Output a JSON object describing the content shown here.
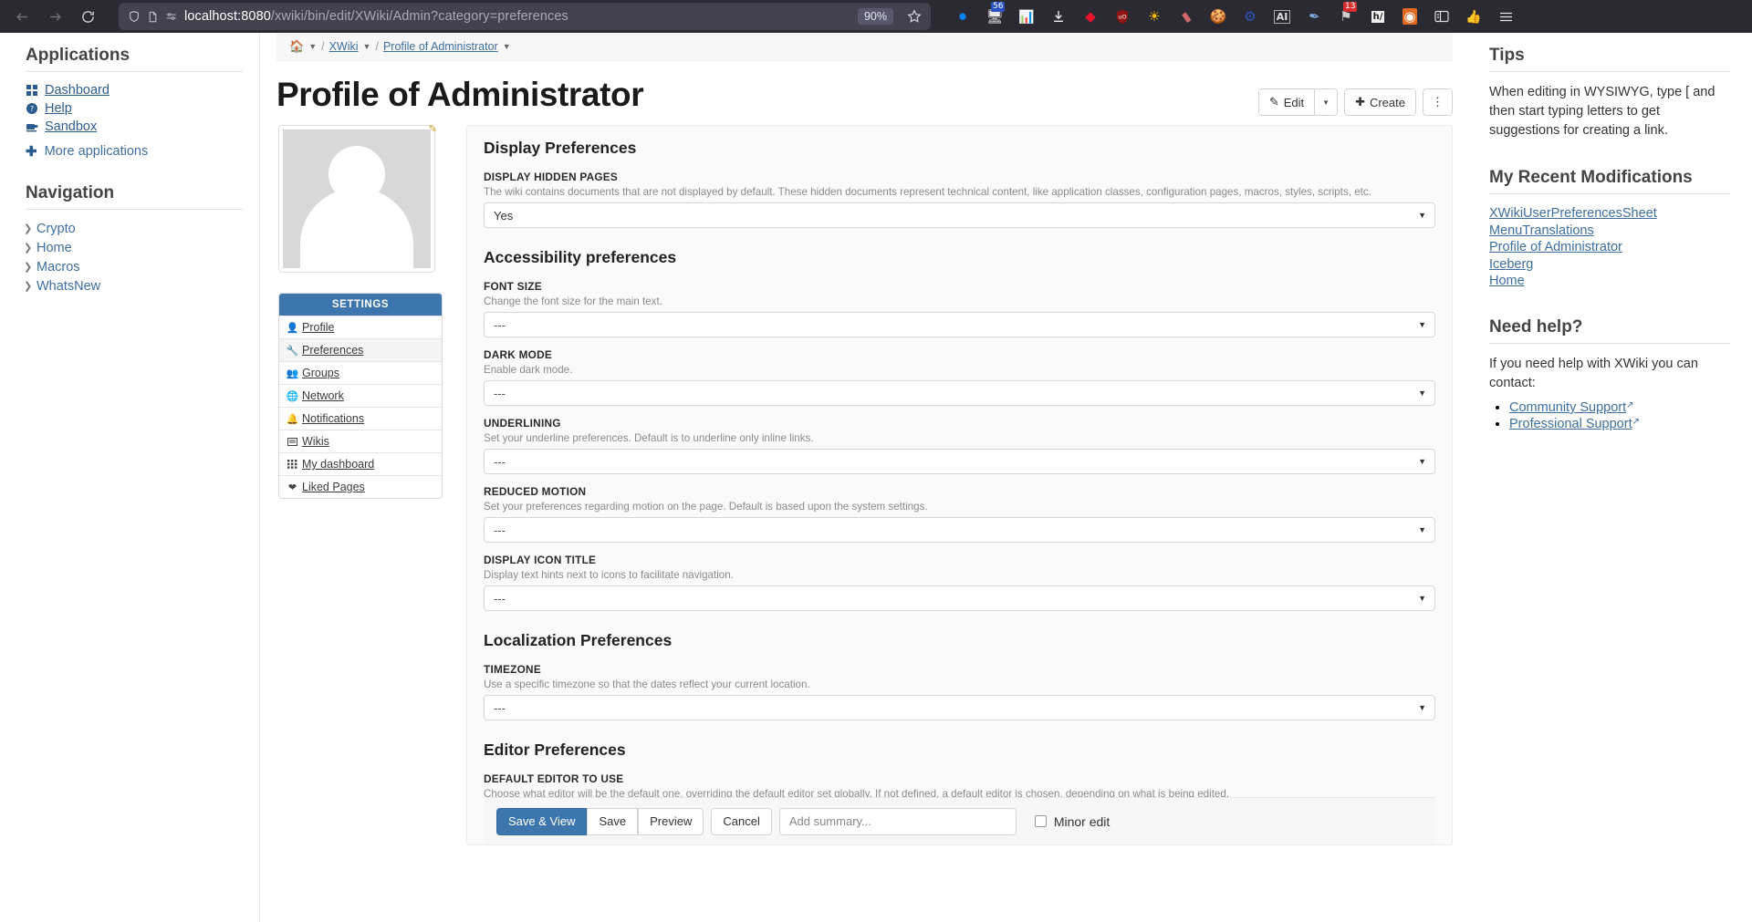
{
  "browser": {
    "back_label": "back",
    "forward_label": "forward",
    "reload_label": "reload",
    "url_host": "localhost:8080",
    "url_path": "/xwiki/bin/edit/XWiki/Admin?category=preferences",
    "zoom_level": "90%",
    "extensions": [
      {
        "name": "profile-avatar-icon",
        "glyph": "●",
        "color": "#0a84ff",
        "badge": ""
      },
      {
        "name": "screen-recorder-icon",
        "glyph": "🖥",
        "color": "#e0e0e0",
        "badge": "56"
      },
      {
        "name": "spreadsheet-icon",
        "glyph": "📊",
        "color": "#dddddd",
        "badge": ""
      },
      {
        "name": "download-icon",
        "glyph": "⬇",
        "color": "#e8e8e8",
        "badge": ""
      },
      {
        "name": "red-diamond-icon",
        "glyph": "◆",
        "color": "#e8142d",
        "badge": ""
      },
      {
        "name": "ublock-shield-icon",
        "glyph": "🛡",
        "color": "#8f1414",
        "badge": ""
      },
      {
        "name": "sun-brightness-icon",
        "glyph": "☀",
        "color": "#ffc107",
        "badge": ""
      },
      {
        "name": "eraser-icon",
        "glyph": "▰",
        "color": "#d4696b",
        "badge": ""
      },
      {
        "name": "cookie-icon",
        "glyph": "🍪",
        "color": "#c88a4a",
        "badge": ""
      },
      {
        "name": "blue-gear-icon",
        "glyph": "⚙",
        "color": "#2a52be",
        "badge": ""
      },
      {
        "name": "ai-icon",
        "glyph": "AI",
        "color": "#dddddd",
        "badge": ""
      },
      {
        "name": "pen-icon",
        "glyph": "✒",
        "color": "#6f9fd8",
        "badge": ""
      },
      {
        "name": "flag-icon",
        "glyph": "⚑",
        "color": "#cccccc",
        "badge": "13"
      },
      {
        "name": "h-note-icon",
        "glyph": "h/",
        "color": "#eeeeee",
        "badge": ""
      },
      {
        "name": "orange-lens-icon",
        "glyph": "◉",
        "color": "#e06a20",
        "badge": ""
      },
      {
        "name": "sidebar-toggle-icon",
        "glyph": "▣",
        "color": "#dddddd",
        "badge": ""
      },
      {
        "name": "thumbs-up-icon",
        "glyph": "👍",
        "color": "#e4e4e4",
        "badge": ""
      },
      {
        "name": "app-menu-icon",
        "glyph": "☰",
        "color": "#e4e4e4",
        "badge": ""
      }
    ]
  },
  "left_sidebar": {
    "applications_title": "Applications",
    "applications": [
      {
        "label": "Dashboard",
        "icon": "dashboard-grid-icon"
      },
      {
        "label": "Help",
        "icon": "help-circle-icon"
      },
      {
        "label": "Sandbox",
        "icon": "coffee-cup-icon"
      }
    ],
    "more_applications": "More applications",
    "navigation_title": "Navigation",
    "navigation": [
      {
        "label": "Crypto"
      },
      {
        "label": "Home"
      },
      {
        "label": "Macros"
      },
      {
        "label": "WhatsNew"
      }
    ]
  },
  "breadcrumb": {
    "home_icon": "home-icon",
    "items": [
      {
        "label": "XWiki",
        "link": true
      },
      {
        "label": "Profile of Administrator",
        "link": true
      }
    ]
  },
  "header": {
    "title": "Profile of Administrator",
    "edit_label": "Edit",
    "create_label": "Create",
    "more_label": "⋮"
  },
  "profile": {
    "avatar_alt": "user-avatar",
    "settings_title": "SETTINGS",
    "settings_items": [
      {
        "label": "Profile",
        "icon": "user-icon",
        "active": false
      },
      {
        "label": "Preferences",
        "icon": "wrench-icon",
        "active": true
      },
      {
        "label": "Groups",
        "icon": "users-icon",
        "active": false
      },
      {
        "label": "Network",
        "icon": "globe-icon",
        "active": false
      },
      {
        "label": "Notifications",
        "icon": "bell-icon",
        "active": false
      },
      {
        "label": "Wikis",
        "icon": "window-icon",
        "active": false
      },
      {
        "label": "My dashboard",
        "icon": "grid-icon",
        "active": false
      },
      {
        "label": "Liked Pages",
        "icon": "heart-icon",
        "active": false
      }
    ]
  },
  "form": {
    "sections": [
      {
        "title": "Display Preferences",
        "fields": [
          {
            "label": "DISPLAY HIDDEN PAGES",
            "hint": "The wiki contains documents that are not displayed by default. These hidden documents represent technical content, like application classes, configuration pages, macros, styles, scripts, etc.",
            "value": "Yes"
          }
        ]
      },
      {
        "title": "Accessibility preferences",
        "fields": [
          {
            "label": "FONT SIZE",
            "hint": "Change the font size for the main text.",
            "value": "---"
          },
          {
            "label": "DARK MODE",
            "hint": "Enable dark mode.",
            "value": "---"
          },
          {
            "label": "UNDERLINING",
            "hint": "Set your underline preferences. Default is to underline only inline links.",
            "value": "---"
          },
          {
            "label": "REDUCED MOTION",
            "hint": "Set your preferences regarding motion on the page. Default is based upon the system settings.",
            "value": "---"
          },
          {
            "label": "DISPLAY ICON TITLE",
            "hint": "Display text hints next to icons to facilitate navigation.",
            "value": "---"
          }
        ]
      },
      {
        "title": "Localization Preferences",
        "fields": [
          {
            "label": "TIMEZONE",
            "hint": "Use a specific timezone so that the dates reflect your current location.",
            "value": "---"
          }
        ]
      },
      {
        "title": "Editor Preferences",
        "fields": [
          {
            "label": "DEFAULT EDITOR TO USE",
            "hint": "Choose what editor will be the default one, overriding the default editor set globally. If not defined, a default editor is chosen, depending on what is being edited.",
            "value": "---"
          }
        ]
      }
    ]
  },
  "actions": {
    "save_and_view": "Save & View",
    "save": "Save",
    "preview": "Preview",
    "cancel": "Cancel",
    "summary_placeholder": "Add summary...",
    "minor_edit": "Minor edit"
  },
  "right_sidebar": {
    "tips_title": "Tips",
    "tips_text": "When editing in WYSIWYG, type [ and then start typing letters to get suggestions for creating a link.",
    "recent_title": "My Recent Modifications",
    "recent_items": [
      "XWikiUserPreferencesSheet",
      "MenuTranslations",
      "Profile of Administrator",
      "Iceberg",
      "Home"
    ],
    "help_title": "Need help?",
    "help_text": "If you need help with XWiki you can contact:",
    "help_links": [
      "Community Support",
      "Professional Support"
    ]
  }
}
